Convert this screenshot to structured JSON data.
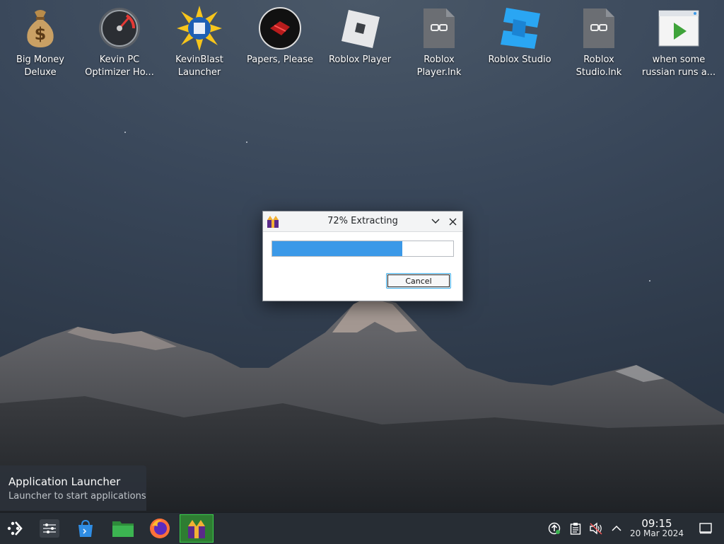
{
  "desktop": {
    "icons": [
      {
        "label": "Big Money Deluxe",
        "icon": "money-bag-icon"
      },
      {
        "label": "Kevin PC Optimizer Ho...",
        "icon": "speedometer-icon"
      },
      {
        "label": "KevinBlast Launcher",
        "icon": "starburst-disk-icon"
      },
      {
        "label": "Papers, Please",
        "icon": "papers-please-icon"
      },
      {
        "label": "Roblox Player",
        "icon": "roblox-player-icon"
      },
      {
        "label": "Roblox Player.lnk",
        "icon": "link-file-icon"
      },
      {
        "label": "Roblox Studio",
        "icon": "roblox-studio-icon"
      },
      {
        "label": "Roblox Studio.lnk",
        "icon": "link-file-icon"
      },
      {
        "label": "when some russian runs a...",
        "icon": "video-file-icon"
      }
    ]
  },
  "dialog": {
    "title": "72% Extracting",
    "progress": 0.72,
    "cancel_label": "Cancel"
  },
  "tooltip": {
    "title": "Application Launcher",
    "subtitle": "Launcher to start applications"
  },
  "taskbar": {
    "tasks": [
      "application-launcher-icon",
      "system-settings-icon",
      "discover-store-icon",
      "file-manager-icon",
      "firefox-icon",
      "installer-app-icon"
    ],
    "tray": [
      "updates-icon",
      "clipboard-icon",
      "volume-muted-icon",
      "chevron-up-icon"
    ],
    "clock": {
      "time": "09:15",
      "date": "20 Mar 2024"
    },
    "show_desktop": "show-desktop-icon"
  },
  "colors": {
    "accent": "#3b99e8",
    "active_task": "#2e7d32",
    "taskbar": "#272d34"
  }
}
